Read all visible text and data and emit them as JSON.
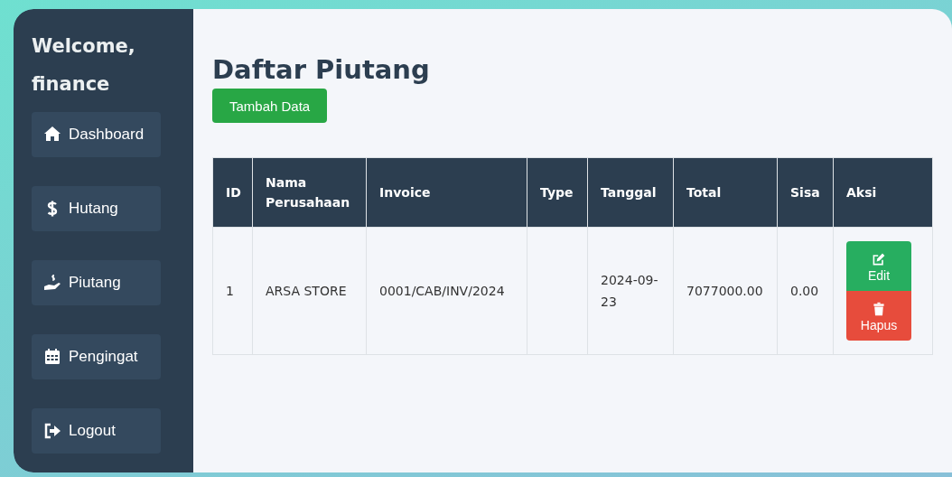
{
  "sidebar": {
    "welcome": "Welcome, finance",
    "items": [
      {
        "kind": "home",
        "label": "Dashboard"
      },
      {
        "kind": "dollar",
        "label": "Hutang"
      },
      {
        "kind": "hand",
        "label": "Piutang"
      },
      {
        "kind": "calendar",
        "label": "Pengingat"
      },
      {
        "kind": "logout",
        "label": "Logout"
      }
    ]
  },
  "page_title": "Daftar Piutang",
  "add_button": "Tambah Data",
  "table": {
    "columns": [
      "ID",
      "Nama Perusahaan",
      "Invoice",
      "Type",
      "Tanggal",
      "Total",
      "Sisa",
      "Aksi"
    ],
    "rows": [
      {
        "id": "1",
        "company": "ARSA STORE",
        "invoice": "0001/CAB/INV/2024",
        "date": "2024-09-23",
        "total": "7077000.00",
        "remaining": "0.00",
        "actions": [
          {
            "kind": "edit",
            "label": "Edit"
          },
          {
            "kind": "delete",
            "label": "Hapus"
          }
        ]
      }
    ]
  }
}
